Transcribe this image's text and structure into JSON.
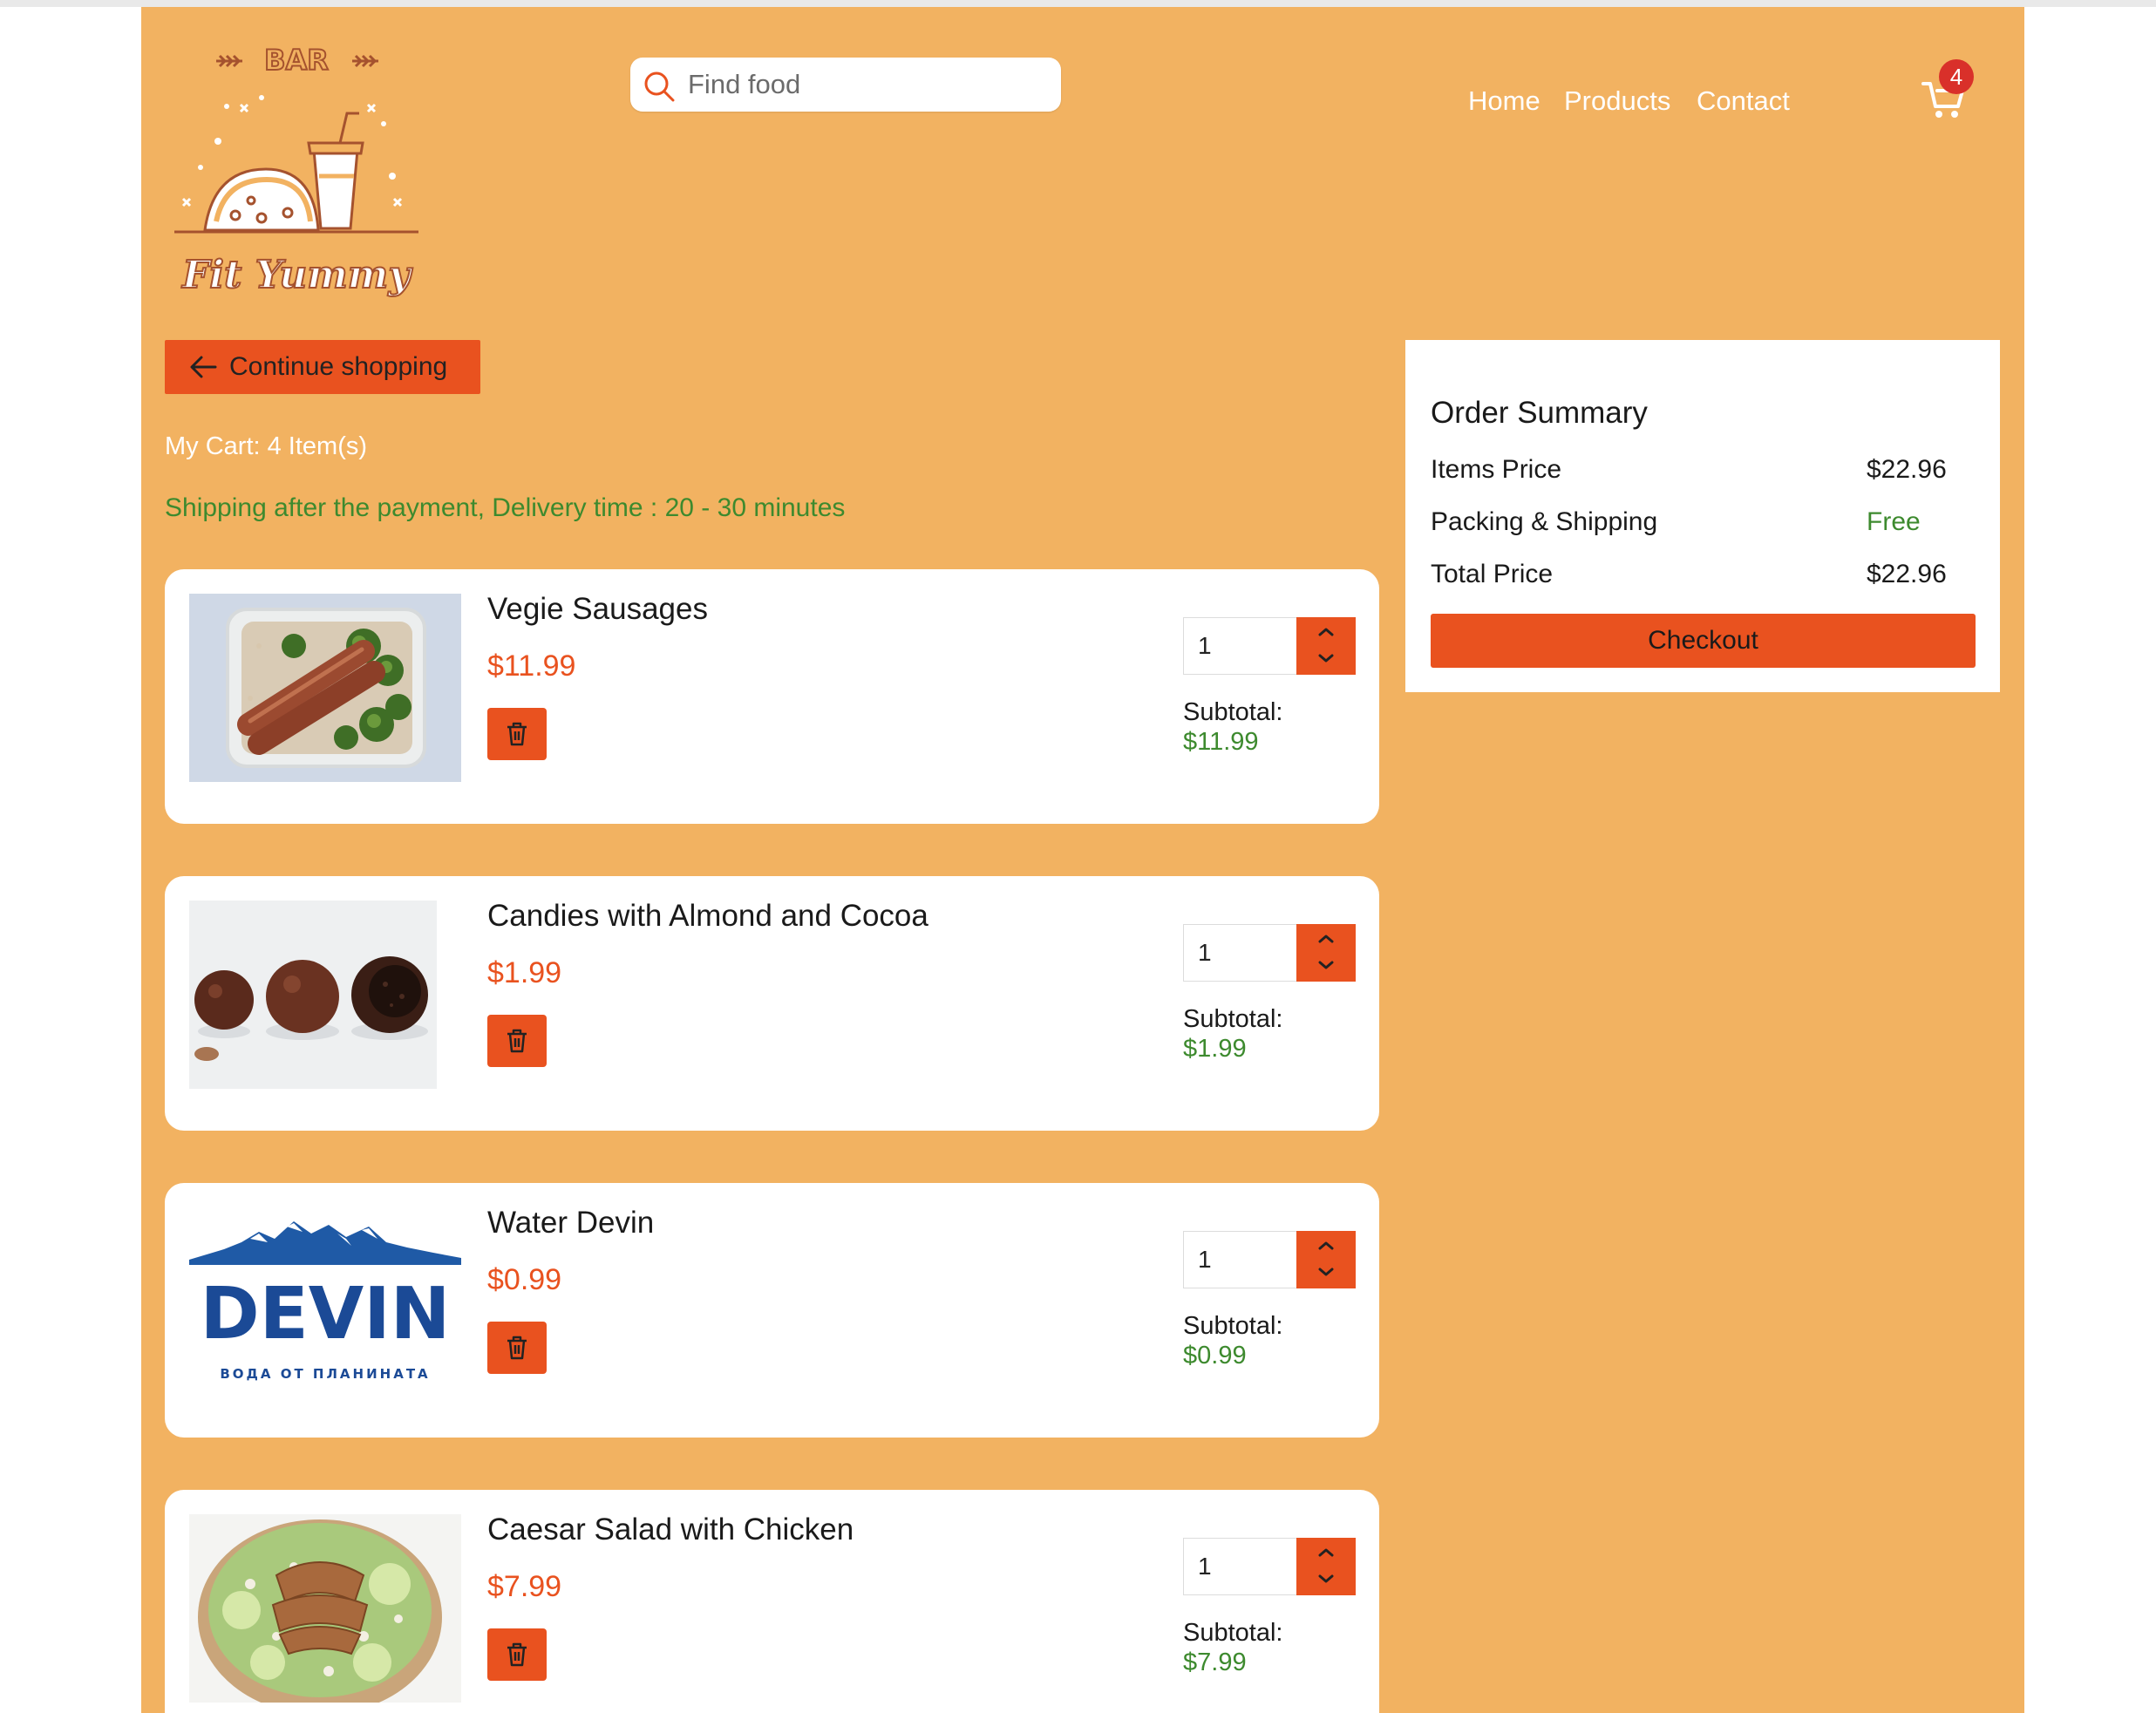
{
  "header": {
    "logo": {
      "top_text": "BAR",
      "brand": "Fit Yummy"
    },
    "search": {
      "placeholder": "Find food",
      "value": ""
    },
    "nav": {
      "home": "Home",
      "products": "Products",
      "contact": "Contact"
    },
    "cart_count": "4"
  },
  "cart": {
    "continue_label": "Continue shopping",
    "summary_text": "My Cart: 4 Item(s)",
    "shipping_note": "Shipping after the payment, Delivery time : 20 - 30 minutes",
    "items": [
      {
        "name": "Vegie Sausages",
        "price": "$11.99",
        "quantity": "1",
        "subtotal_label": "Subtotal:",
        "subtotal": "$11.99"
      },
      {
        "name": "Candies with Almond and Cocoa",
        "price": "$1.99",
        "quantity": "1",
        "subtotal_label": "Subtotal:",
        "subtotal": "$1.99"
      },
      {
        "name": "Water Devin",
        "price": "$0.99",
        "quantity": "1",
        "subtotal_label": "Subtotal:",
        "subtotal": "$0.99",
        "logo_text": "DEVIN",
        "logo_subtext": "ВОДА ОТ ПЛАНИНАТА"
      },
      {
        "name": "Caesar Salad with Chicken",
        "price": "$7.99",
        "quantity": "1",
        "subtotal_label": "Subtotal:",
        "subtotal": "$7.99"
      }
    ]
  },
  "order_summary": {
    "title": "Order Summary",
    "items_price_label": "Items Price",
    "items_price": "$22.96",
    "shipping_label": "Packing & Shipping",
    "shipping_value": "Free",
    "total_label": "Total Price",
    "total_price": "$22.96",
    "checkout_label": "Checkout"
  },
  "colors": {
    "page_background": "#f2b261",
    "accent": "#e9521f",
    "success_green": "#3d8a2e",
    "badge_red": "#d9302a"
  },
  "icons": [
    "search-icon",
    "cart-icon",
    "arrow-left-icon",
    "trash-icon",
    "chevron-up-icon",
    "chevron-down-icon"
  ]
}
